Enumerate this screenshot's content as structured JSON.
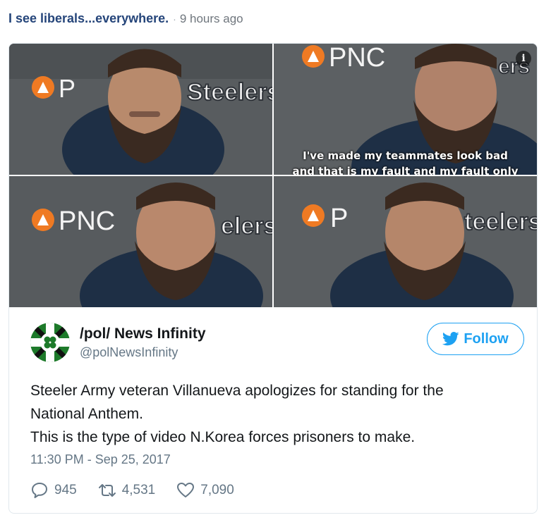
{
  "post": {
    "title": "I see liberals...everywhere.",
    "separator": "·",
    "time_ago": "9 hours ago"
  },
  "media": {
    "logo_text": "PNC",
    "logo_text_partial_1": "P",
    "logo_text_partial_4": "P",
    "steelers_text_1": "Steelers",
    "steelers_text_2": "ers",
    "steelers_text_3": "elers",
    "steelers_text_4": "teelers",
    "caption_line_1": "I've made my teammates look bad",
    "caption_line_2": "and that is my fault and my fault only",
    "info_symbol": "i"
  },
  "author": {
    "name": "/pol/ News Infinity",
    "handle": "@polNewsInfinity",
    "avatar_icon": "flag-clover-icon"
  },
  "follow": {
    "label": "Follow",
    "icon": "twitter-bird-icon"
  },
  "tweet": {
    "line1": "Steeler Army veteran Villanueva apologizes for standing for the",
    "line2": "National Anthem.",
    "line3": "This is the type of video N.Korea forces prisoners to make.",
    "timestamp": "11:30 PM - Sep 25, 2017"
  },
  "actions": {
    "replies": "945",
    "retweets": "4,531",
    "likes": "7,090"
  },
  "colors": {
    "title": "#25457a",
    "twitter_blue": "#1da1f2",
    "muted": "#657786",
    "pnc_orange": "#ef7a23"
  }
}
